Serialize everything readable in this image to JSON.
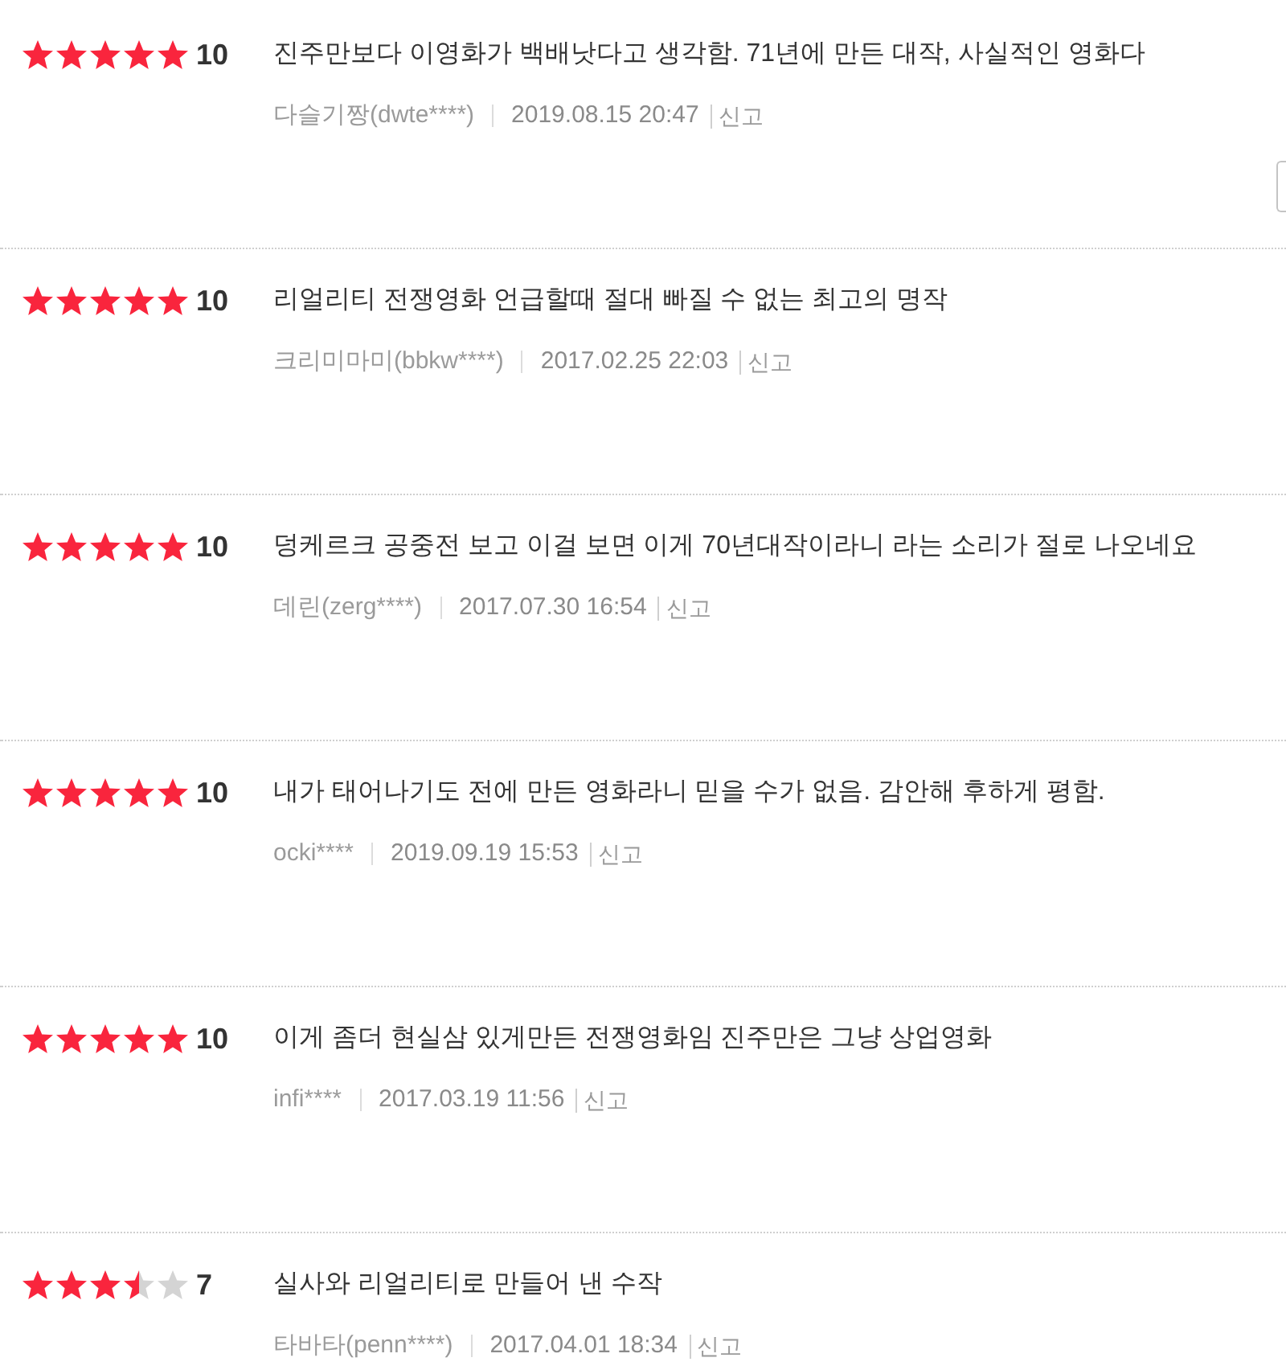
{
  "reviews": [
    {
      "stars": 5,
      "score": "10",
      "text": "진주만보다 이영화가 백배낫다고 생각함. 71년에 만든 대작, 사실적인 영화다",
      "author": "다슬기짱(dwte****)",
      "date": "2019.08.15 20:47",
      "report": "신고"
    },
    {
      "stars": 5,
      "score": "10",
      "text": "리얼리티 전쟁영화 언급할때 절대 빠질 수 없는 최고의 명작",
      "author": "크리미마미(bbkw****)",
      "date": "2017.02.25 22:03",
      "report": "신고"
    },
    {
      "stars": 5,
      "score": "10",
      "text": "덩케르크 공중전 보고 이걸 보면 이게 70년대작이라니 라는 소리가 절로 나오네요",
      "author": "데린(zerg****)",
      "date": "2017.07.30 16:54",
      "report": "신고"
    },
    {
      "stars": 5,
      "score": "10",
      "text": "내가 태어나기도 전에 만든 영화라니 믿을 수가 없음. 감안해 후하게 평함.",
      "author": "ocki****",
      "date": "2019.09.19 15:53",
      "report": "신고"
    },
    {
      "stars": 5,
      "score": "10",
      "text": "이게 좀더 현실삼 있게만든 전쟁영화임 진주만은 그냥 상업영화",
      "author": "infi****",
      "date": "2017.03.19 11:56",
      "report": "신고"
    },
    {
      "stars": 3.5,
      "score": "7",
      "text": "실사와 리얼리티로 만들어 낸 수작",
      "author": "타바타(penn****)",
      "date": "2017.04.01 18:34",
      "report": "신고"
    }
  ]
}
